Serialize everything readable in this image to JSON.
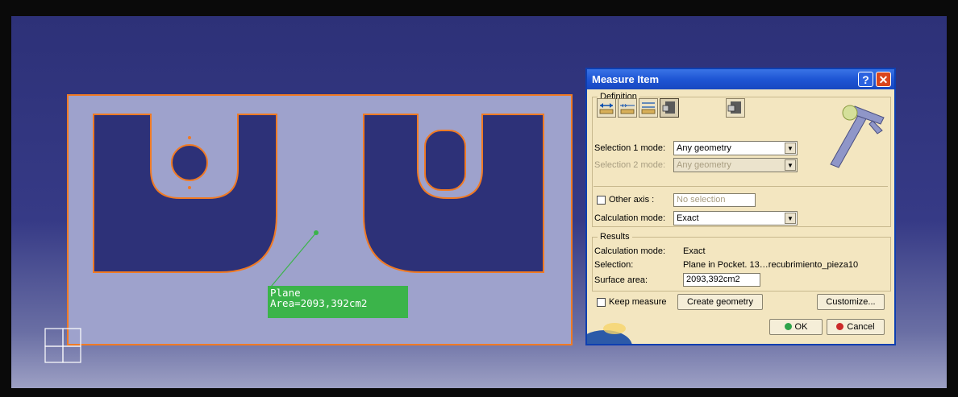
{
  "viewport": {
    "callout": {
      "line1": "Plane",
      "line2": "Area=2093,392cm2"
    },
    "colors": {
      "background": "#2d3178",
      "part_face": "#9ea2cc",
      "edge_highlight": "#f07a24",
      "callout": "#3bb44a"
    }
  },
  "dialog": {
    "title": "Measure Item",
    "help_button": "?",
    "close_button": "✕",
    "definition": {
      "legend": "Definition",
      "tools": [
        {
          "name": "measure-between-icon"
        },
        {
          "name": "measure-in-chain-icon"
        },
        {
          "name": "measure-fan-icon"
        },
        {
          "name": "measure-item-icon"
        },
        {
          "name": "measure-thickness-icon"
        }
      ],
      "selection1_label": "Selection 1 mode:",
      "selection1_value": "Any geometry",
      "selection2_label": "Selection 2 mode:",
      "selection2_value": "Any geometry",
      "other_axis_label": "Other axis :",
      "other_axis_value": "No selection",
      "calc_mode_label": "Calculation mode:",
      "calc_mode_value": "Exact"
    },
    "results": {
      "legend": "Results",
      "calc_mode_label": "Calculation mode:",
      "calc_mode_value": "Exact",
      "selection_label": "Selection:",
      "selection_value": "Plane in Pocket. 13…recubrimiento_pieza10",
      "surface_area_label": "Surface area:",
      "surface_area_value": "2093,392cm2"
    },
    "keep_measure_label": "Keep measure",
    "create_geometry_label": "Create geometry",
    "customize_label": "Customize...",
    "ok_label": "OK",
    "cancel_label": "Cancel"
  }
}
